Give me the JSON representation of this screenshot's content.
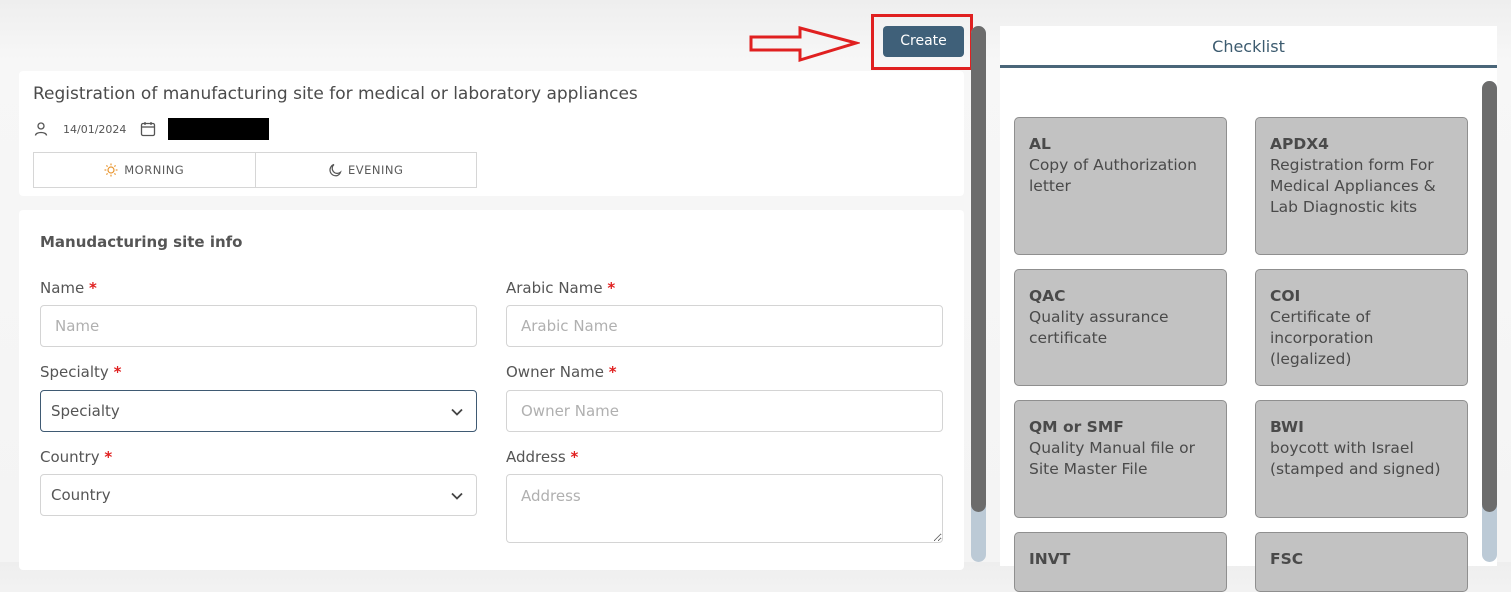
{
  "toolbar": {
    "create_label": "Create"
  },
  "header": {
    "title": "Registration of manufacturing site for medical or laboratory appliances",
    "date": "14/01/2024",
    "shifts": [
      {
        "label": "MORNING",
        "icon": "sun-icon"
      },
      {
        "label": "EVENING",
        "icon": "moon-icon"
      }
    ]
  },
  "form": {
    "section_title": "Manudacturing site info",
    "name": {
      "label": "Name",
      "required": "*",
      "placeholder": "Name"
    },
    "arabic_name": {
      "label": "Arabic Name",
      "required": "*",
      "placeholder": "Arabic Name"
    },
    "specialty": {
      "label": "Specialty",
      "required": "*",
      "value": "Specialty"
    },
    "owner_name": {
      "label": "Owner Name",
      "required": "*",
      "placeholder": "Owner Name"
    },
    "country": {
      "label": "Country",
      "required": "*",
      "value": "Country"
    },
    "address": {
      "label": "Address",
      "required": "*",
      "placeholder": "Address"
    }
  },
  "checklist": {
    "tab_label": "Checklist",
    "items": [
      {
        "code": "AL",
        "desc": "Copy of Authorization letter"
      },
      {
        "code": "APDX4",
        "desc": "Registration form For Medical Appliances & Lab Diagnostic kits"
      },
      {
        "code": "QAC",
        "desc": "Quality assurance certificate"
      },
      {
        "code": "COI",
        "desc": "Certificate of incorporation (legalized)"
      },
      {
        "code": "QM or SMF",
        "desc": "Quality Manual file or Site Master File"
      },
      {
        "code": "BWI",
        "desc": "boycott with Israel (stamped and signed)"
      },
      {
        "code": "INVT",
        "desc": ""
      },
      {
        "code": "FSC",
        "desc": ""
      }
    ]
  },
  "colors": {
    "accent": "#3f6079",
    "annotation_red": "#e02020",
    "tile_bg": "#c2c2c2",
    "required": "#e02020"
  }
}
